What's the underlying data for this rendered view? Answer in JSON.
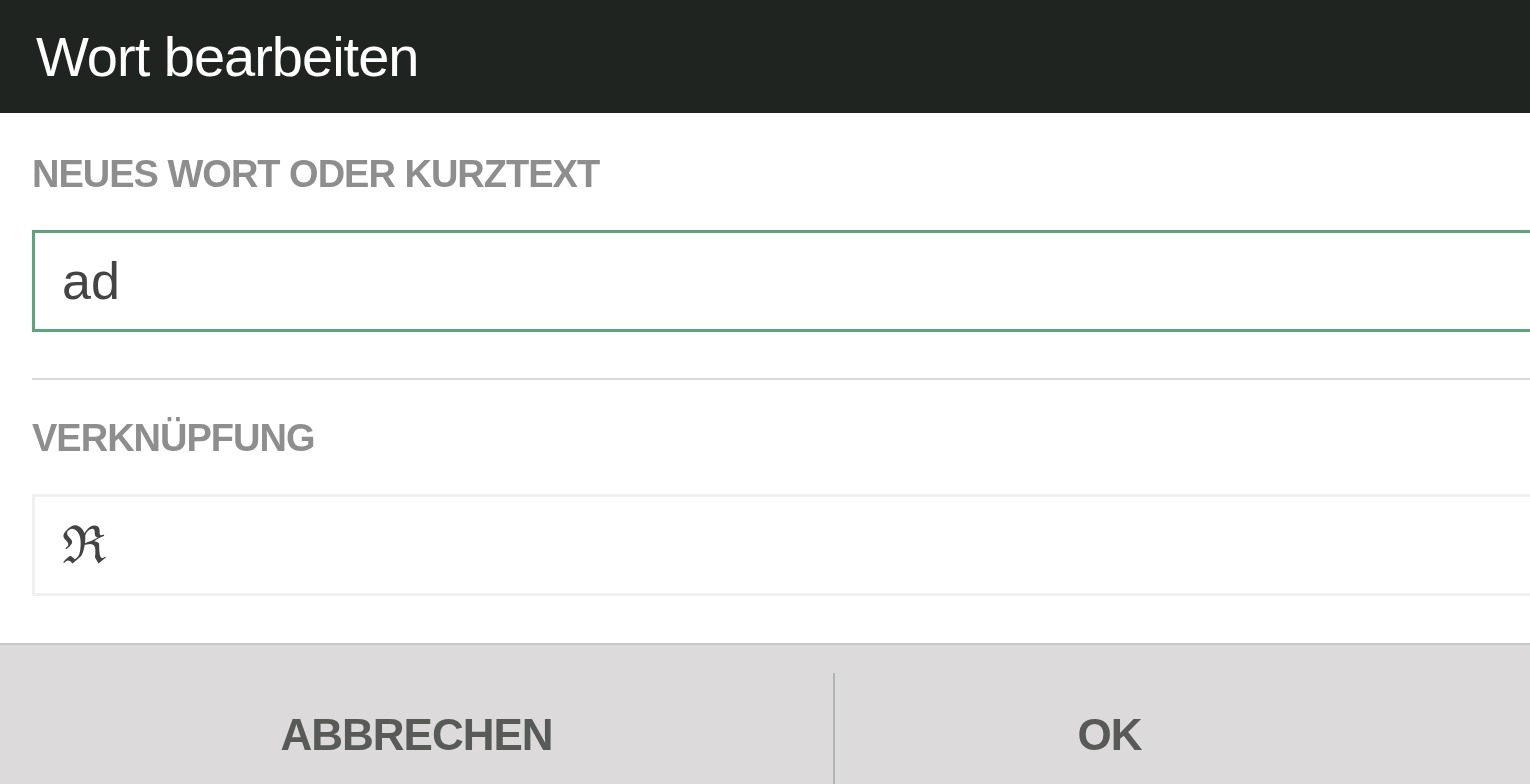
{
  "dialog": {
    "title": "Wort bearbeiten"
  },
  "fields": [
    {
      "label": "NEUES WORT ODER KURZTEXT",
      "value": "ad",
      "focused": true
    },
    {
      "label": "VERKNÜPFUNG",
      "value": "ℜ",
      "focused": false
    }
  ],
  "buttons": [
    {
      "label": "ABBRECHEN"
    },
    {
      "label": "OK"
    }
  ]
}
